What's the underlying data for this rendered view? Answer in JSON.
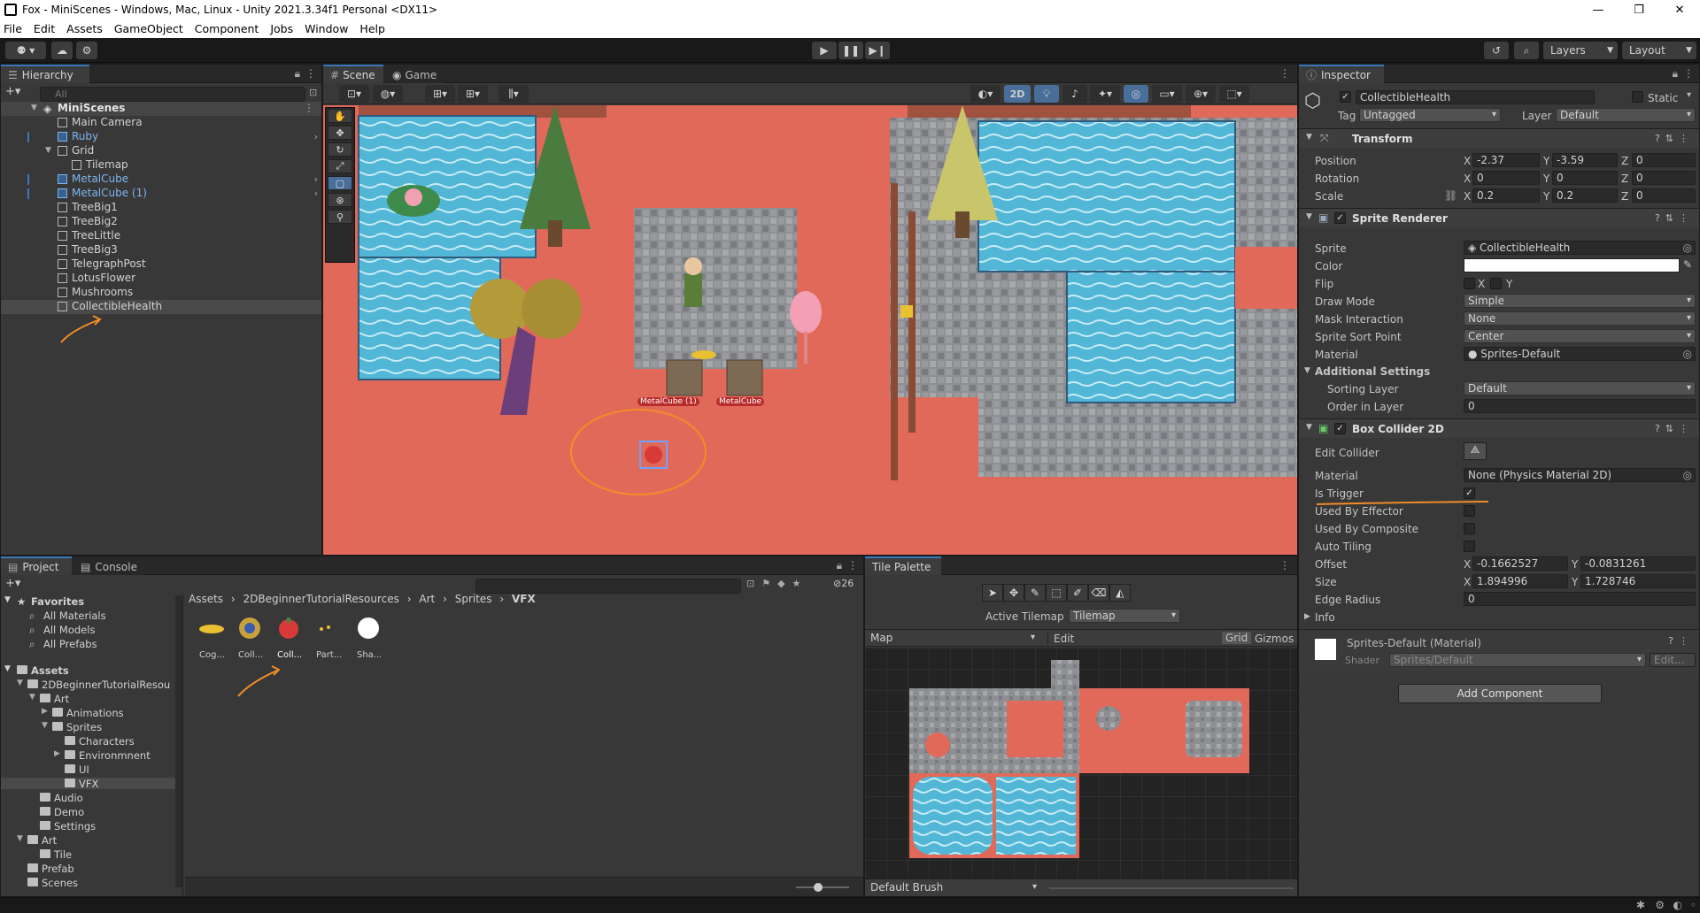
{
  "window": {
    "title": "Fox - MiniScenes - Windows, Mac, Linux - Unity 2021.3.34f1 Personal <DX11>",
    "controls": [
      "—",
      "❐",
      "✕"
    ]
  },
  "menu": [
    "File",
    "Edit",
    "Assets",
    "GameObject",
    "Component",
    "Jobs",
    "Window",
    "Help"
  ],
  "toolbar": {
    "account": "⚉ ▾",
    "layers": "Layers",
    "layout": "Layout"
  },
  "hierarchy": {
    "tab": "Hierarchy",
    "search_placeholder": "All",
    "scene": "MiniScenes",
    "items": [
      {
        "label": "Main Camera",
        "indent": 1
      },
      {
        "label": "Ruby",
        "indent": 1,
        "blue": true,
        "expand": true
      },
      {
        "label": "Grid",
        "indent": 1
      },
      {
        "label": "Tilemap",
        "indent": 2
      },
      {
        "label": "MetalCube",
        "indent": 1,
        "blue": true,
        "expand": true
      },
      {
        "label": "MetalCube (1)",
        "indent": 1,
        "blue": true,
        "expand": true
      },
      {
        "label": "TreeBig1",
        "indent": 1
      },
      {
        "label": "TreeBig2",
        "indent": 1
      },
      {
        "label": "TreeLittle",
        "indent": 1
      },
      {
        "label": "TreeBig3",
        "indent": 1
      },
      {
        "label": "TelegraphPost",
        "indent": 1
      },
      {
        "label": "LotusFlower",
        "indent": 1
      },
      {
        "label": "Mushrooms",
        "indent": 1
      },
      {
        "label": "CollectibleHealth",
        "indent": 1,
        "selected": true
      }
    ]
  },
  "scene_tabs": {
    "scene": "Scene",
    "game": "Game",
    "mode_2d": "2D"
  },
  "scene_labels": {
    "metalcube1": "MetalCube (1)",
    "metalcube": "MetalCube"
  },
  "project": {
    "tab_project": "Project",
    "tab_console": "Console",
    "count": "26",
    "favorites": {
      "label": "Favorites",
      "items": [
        "All Materials",
        "All Models",
        "All Prefabs"
      ]
    },
    "assets_label": "Assets",
    "tree": [
      {
        "label": "2DBeginnerTutorialResou",
        "indent": 1
      },
      {
        "label": "Art",
        "indent": 2
      },
      {
        "label": "Animations",
        "indent": 3
      },
      {
        "label": "Sprites",
        "indent": 3
      },
      {
        "label": "Characters",
        "indent": 4
      },
      {
        "label": "Environmnent",
        "indent": 4
      },
      {
        "label": "UI",
        "indent": 4
      },
      {
        "label": "VFX",
        "indent": 4,
        "selected": true
      },
      {
        "label": "Audio",
        "indent": 2
      },
      {
        "label": "Demo",
        "indent": 2
      },
      {
        "label": "Settings",
        "indent": 2
      },
      {
        "label": "Art",
        "indent": 1
      },
      {
        "label": "Tile",
        "indent": 2
      },
      {
        "label": "Prefab",
        "indent": 1
      },
      {
        "label": "Scenes",
        "indent": 1
      }
    ],
    "breadcrumb": [
      "Assets",
      "2DBeginnerTutorialResources",
      "Art",
      "Sprites",
      "VFX"
    ],
    "assets": [
      "Cog...",
      "Coll...",
      "Coll...",
      "Part...",
      "Sha..."
    ]
  },
  "tile_palette": {
    "tab": "Tile Palette",
    "active_tilemap_label": "Active Tilemap",
    "active_tilemap": "Tilemap",
    "palette": "Map",
    "edit": "Edit",
    "grid": "Grid",
    "gizmos": "Gizmos",
    "brush": "Default Brush"
  },
  "inspector": {
    "tab": "Inspector",
    "object_name": "CollectibleHealth",
    "static": "Static",
    "tag_label": "Tag",
    "tag": "Untagged",
    "layer_label": "Layer",
    "layer": "Default",
    "transform": {
      "title": "Transform",
      "position": {
        "label": "Position",
        "x": "-2.37",
        "y": "-3.59",
        "z": "0"
      },
      "rotation": {
        "label": "Rotation",
        "x": "0",
        "y": "0",
        "z": "0"
      },
      "scale": {
        "label": "Scale",
        "x": "0.2",
        "y": "0.2",
        "z": "0"
      }
    },
    "sprite_renderer": {
      "title": "Sprite Renderer",
      "sprite_label": "Sprite",
      "sprite": "CollectibleHealth",
      "color_label": "Color",
      "flip_label": "Flip",
      "flip_x": "X",
      "flip_y": "Y",
      "draw_mode_label": "Draw Mode",
      "draw_mode": "Simple",
      "mask_label": "Mask Interaction",
      "mask": "None",
      "sort_point_label": "Sprite Sort Point",
      "sort_point": "Center",
      "material_label": "Material",
      "material": "Sprites-Default",
      "additional": "Additional Settings",
      "sorting_layer_label": "Sorting Layer",
      "sorting_layer": "Default",
      "order_label": "Order in Layer",
      "order": "0"
    },
    "box_collider": {
      "title": "Box Collider 2D",
      "edit_label": "Edit Collider",
      "material_label": "Material",
      "material": "None (Physics Material 2D)",
      "trigger_label": "Is Trigger",
      "effector_label": "Used By Effector",
      "composite_label": "Used By Composite",
      "tiling_label": "Auto Tiling",
      "offset_label": "Offset",
      "offset_x": "-0.1662527",
      "offset_y": "-0.0831261",
      "size_label": "Size",
      "size_x": "1.894996",
      "size_y": "1.728746",
      "radius_label": "Edge Radius",
      "radius": "0",
      "info_label": "Info"
    },
    "material": {
      "name": "Sprites-Default (Material)",
      "shader_label": "Shader",
      "shader": "Sprites/Default",
      "edit": "Edit..."
    },
    "add_component": "Add Component",
    "axis": {
      "x": "X",
      "y": "Y",
      "z": "Z"
    }
  },
  "colors": {
    "accent": "#3a79bb",
    "annotation": "#f28c28",
    "water": "#4fb8d8",
    "ground": "#e0695a"
  }
}
